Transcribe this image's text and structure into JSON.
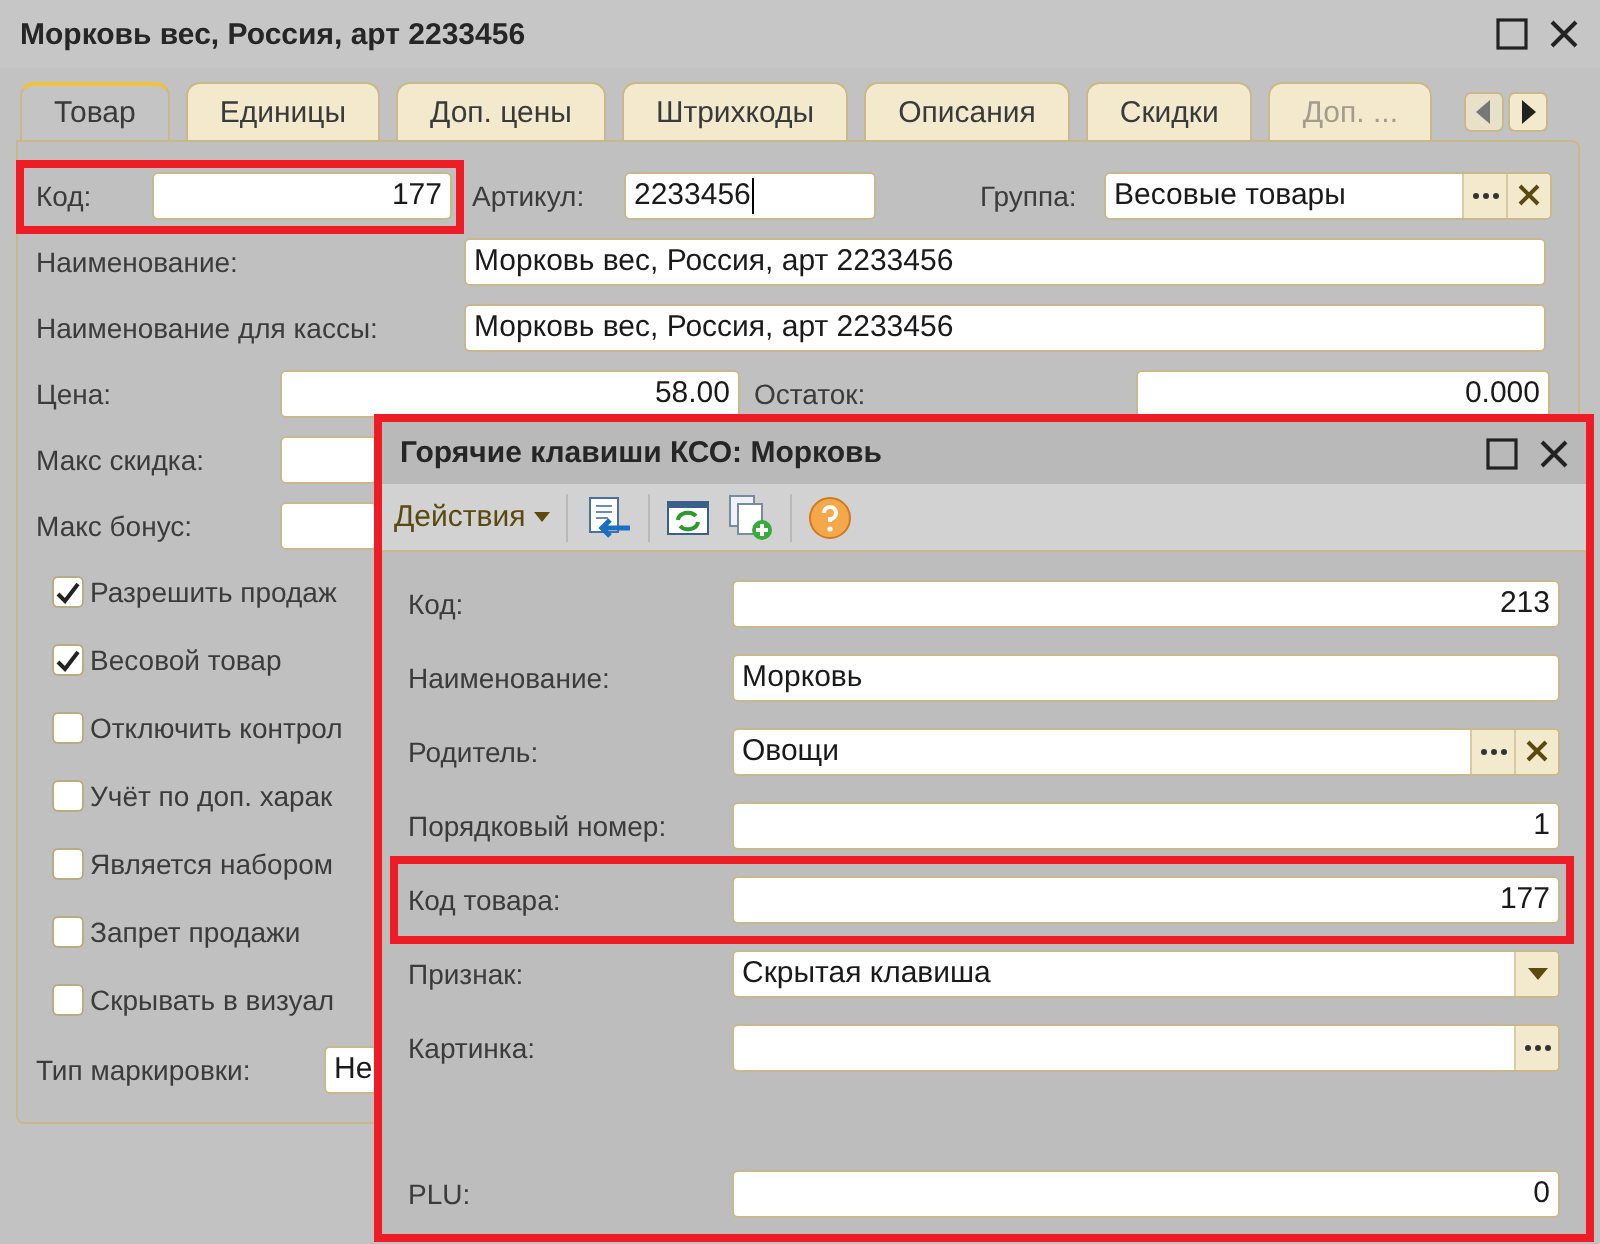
{
  "window": {
    "title": "Морковь вес, Россия, арт 2233456"
  },
  "tabs": [
    {
      "label": "Товар",
      "selected": true,
      "disabled": false
    },
    {
      "label": "Единицы",
      "selected": false,
      "disabled": false
    },
    {
      "label": "Доп. цены",
      "selected": false,
      "disabled": false
    },
    {
      "label": "Штрихкоды",
      "selected": false,
      "disabled": false
    },
    {
      "label": "Описания",
      "selected": false,
      "disabled": false
    },
    {
      "label": "Скидки",
      "selected": false,
      "disabled": false
    },
    {
      "label": "Доп. ...",
      "selected": false,
      "disabled": true
    }
  ],
  "header_row": {
    "code": {
      "label": "Код:",
      "value": "177",
      "highlighted": true
    },
    "article": {
      "label": "Артикул:",
      "value": "2233456",
      "focused": true
    },
    "group": {
      "label": "Группа:",
      "value": "Весовые товары"
    }
  },
  "name_rows": [
    {
      "label": "Наименование:",
      "value": "Морковь вес, Россия, арт 2233456"
    },
    {
      "label": "Наименование для кассы:",
      "value": "Морковь вес, Россия, арт 2233456"
    }
  ],
  "price_row": {
    "price": {
      "label": "Цена:",
      "value": "58.00"
    },
    "stock": {
      "label": "Остаток:",
      "value": "0.000"
    }
  },
  "limit_rows": [
    {
      "label": "Макс скидка:"
    },
    {
      "label": "Макс бонус:"
    }
  ],
  "checkboxes": [
    {
      "label": "Разрешить продаж",
      "checked": true
    },
    {
      "label": "Весовой товар",
      "checked": true
    },
    {
      "label": "Отключить контрол",
      "checked": false
    },
    {
      "label": "Учёт по доп. харак",
      "checked": false
    },
    {
      "label": "Является набором",
      "checked": false
    },
    {
      "label": "Запрет продажи",
      "checked": false
    },
    {
      "label": "Скрывать в визуал",
      "checked": false
    }
  ],
  "marking": {
    "label": "Тип маркировки:",
    "value": "Не"
  },
  "dialog": {
    "title": "Горячие клавиши КСО: Морковь",
    "actions_menu": "Действия",
    "fields": [
      {
        "label": "Код:",
        "value": "213",
        "kind": "number",
        "highlighted": false
      },
      {
        "label": "Наименование:",
        "value": "Морковь",
        "kind": "text",
        "highlighted": false
      },
      {
        "label": "Родитель:",
        "value": "Овощи",
        "kind": "choice",
        "highlighted": false
      },
      {
        "label": "Порядковый номер:",
        "value": "1",
        "kind": "number",
        "highlighted": false
      },
      {
        "label": "Код товара:",
        "value": "177",
        "kind": "number",
        "highlighted": true
      },
      {
        "label": "Признак:",
        "value": "Скрытая клавиша",
        "kind": "dropdown",
        "highlighted": false
      },
      {
        "label": "Картинка:",
        "kind": "picker",
        "highlighted": false
      },
      {
        "label": "PLU:",
        "value": "0",
        "kind": "number",
        "highlighted": false
      }
    ]
  }
}
